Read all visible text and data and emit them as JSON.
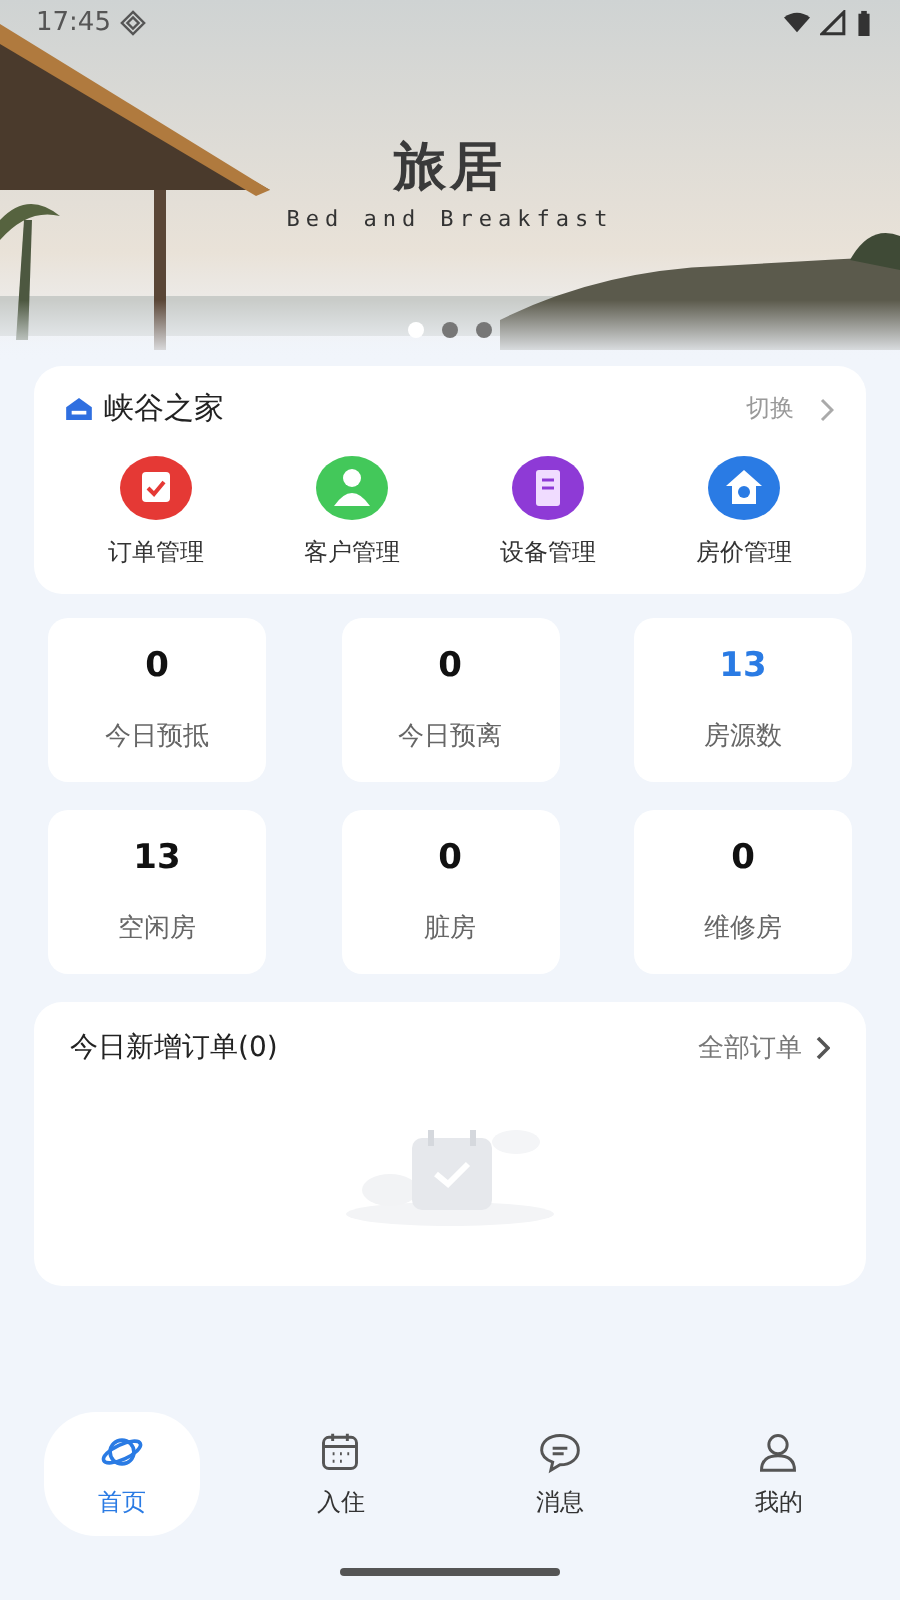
{
  "status_bar": {
    "time": "17:45"
  },
  "banner": {
    "title": "旅居",
    "subtitle": "Bed and Breakfast",
    "dots": [
      {
        "selected": true
      },
      {
        "selected": false
      },
      {
        "selected": false
      }
    ]
  },
  "property": {
    "name": "峡谷之家",
    "switch_label": "切换",
    "actions": [
      {
        "label": "订单管理",
        "color": "#e53935"
      },
      {
        "label": "客户管理",
        "color": "#43c85a"
      },
      {
        "label": "设备管理",
        "color": "#8e3ad6"
      },
      {
        "label": "房价管理",
        "color": "#2a7be4"
      }
    ]
  },
  "stats": [
    {
      "value": "0",
      "label": "今日预抵",
      "accent": false
    },
    {
      "value": "0",
      "label": "今日预离",
      "accent": false
    },
    {
      "value": "13",
      "label": "房源数",
      "accent": true
    },
    {
      "value": "13",
      "label": "空闲房",
      "accent": false
    },
    {
      "value": "0",
      "label": "脏房",
      "accent": false
    },
    {
      "value": "0",
      "label": "维修房",
      "accent": false
    }
  ],
  "orders": {
    "title": "今日新增订单(0)",
    "link": "全部订单"
  },
  "tabs": [
    {
      "label": "首页",
      "selected": true
    },
    {
      "label": "入住",
      "selected": false
    },
    {
      "label": "消息",
      "selected": false
    },
    {
      "label": "我的",
      "selected": false
    }
  ]
}
